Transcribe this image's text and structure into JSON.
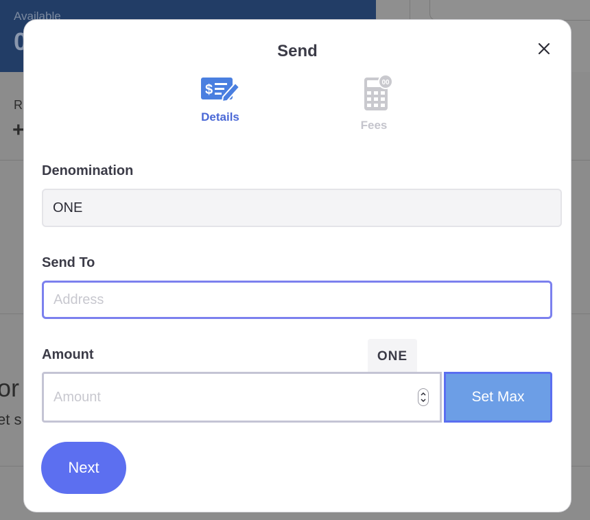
{
  "background": {
    "balance_label": "Available",
    "balance_value": "0",
    "partial_label_r": "R",
    "partial_plus": "+",
    "partial_heading": "or",
    "partial_sub": "et s"
  },
  "modal": {
    "title": "Send",
    "close_icon": "close-icon",
    "steps": [
      {
        "label": "Details",
        "icon": "check-edit-icon",
        "active": true
      },
      {
        "label": "Fees",
        "icon": "calculator-icon",
        "active": false
      }
    ],
    "denomination": {
      "label": "Denomination",
      "value": "ONE"
    },
    "send_to": {
      "label": "Send To",
      "placeholder": "Address",
      "value": ""
    },
    "amount": {
      "label": "Amount",
      "unit": "ONE",
      "placeholder": "Amount",
      "value": "",
      "set_max_label": "Set Max"
    },
    "next_label": "Next"
  },
  "colors": {
    "accent": "#5c6ff0",
    "active_step": "#4a68d6",
    "inactive_step": "#c4c4cc",
    "set_max": "#6c9ee6"
  }
}
